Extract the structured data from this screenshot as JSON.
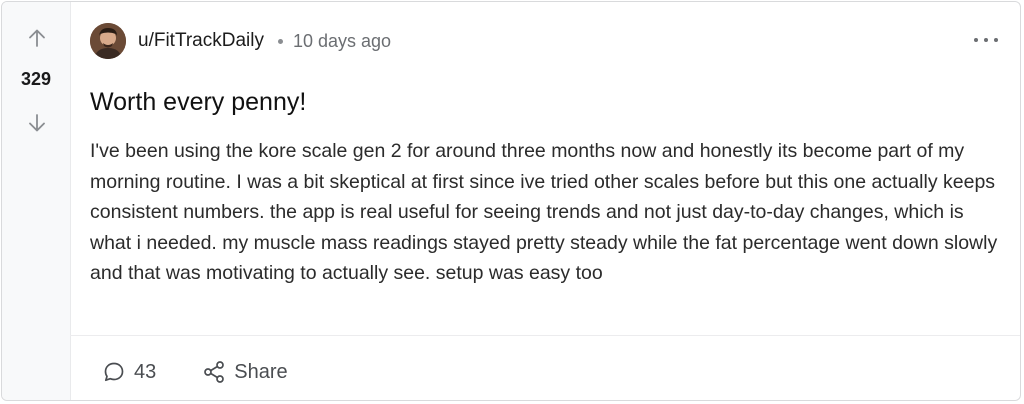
{
  "post": {
    "score": "329",
    "author": "u/FitTrackDaily",
    "separator": "•",
    "time_ago": "10 days ago",
    "title": "Worth every penny!",
    "body": "I've been using the kore scale gen 2 for around three months now and honestly its become part of my morning routine. I was a bit skeptical at first since ive tried other scales before but this one actually keeps consistent numbers. the app is real useful for seeing trends and not just day-to-day changes, which is what i needed. my muscle mass readings stayed pretty steady while the fat percentage went down slowly and that was motivating to actually see. setup was easy too"
  },
  "actions": {
    "comments_count": "43",
    "share_label": "Share"
  },
  "icons": {
    "upvote": "arrow-up-icon",
    "downvote": "arrow-down-icon",
    "comments": "comment-bubble-icon",
    "share": "share-nodes-icon",
    "more": "more-horizontal-icon"
  },
  "colors": {
    "vote_column_bg": "#f8f9fa",
    "border": "#d9dadc",
    "muted_text": "#6b6e72"
  }
}
